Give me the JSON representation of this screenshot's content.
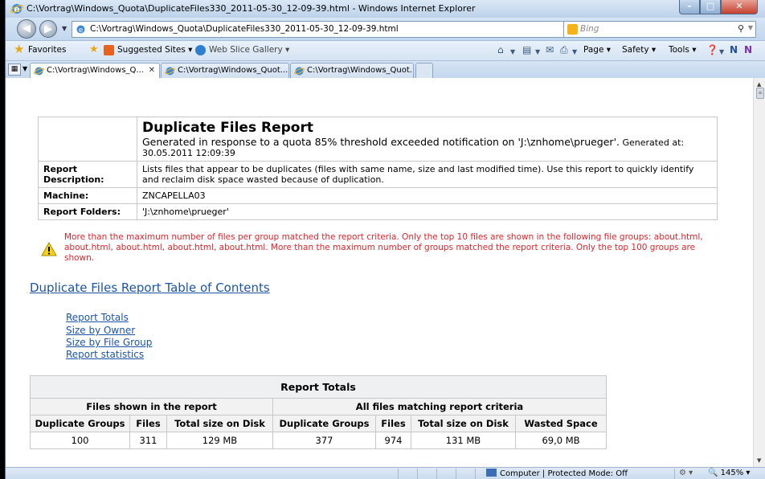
{
  "window": {
    "title": "C:\\Vortrag\\Windows_Quota\\DuplicateFiles330_2011-05-30_12-09-39.html - Windows Internet Explorer",
    "controls": {
      "minimize": "–",
      "maximize": "□",
      "close": "✕"
    }
  },
  "address": {
    "url": "C:\\Vortrag\\Windows_Quota\\DuplicateFiles330_2011-05-30_12-09-39.html",
    "search_placeholder": "Bing"
  },
  "favorites_bar": {
    "favorites": "Favorites",
    "suggested_sites": "Suggested Sites ▾",
    "web_slice_gallery": "Web Slice Gallery ▾"
  },
  "command_bar": {
    "page": "Page ▾",
    "safety": "Safety ▾",
    "tools": "Tools ▾"
  },
  "tabs": [
    {
      "label": "C:\\Vortrag\\Windows_Q...",
      "active": true
    },
    {
      "label": "C:\\Vortrag\\Windows_Quot...",
      "active": false
    },
    {
      "label": "C:\\Vortrag\\Windows_Quot...",
      "active": false
    }
  ],
  "report": {
    "title": "Duplicate Files Report",
    "subtitle": "Generated in response to a quota 85% threshold exceeded notification on 'J:\\znhome\\prueger'.",
    "generated": "Generated at: 30.05.2011 12:09:39",
    "rows": [
      {
        "label": "Report Description:",
        "value": "Lists files that appear to be duplicates (files with same name, size and last modified time). Use this report to quickly identify and reclaim disk space wasted because of duplication."
      },
      {
        "label": "Machine:",
        "value": "ZNCAPELLA03"
      },
      {
        "label": "Report Folders:",
        "value": "'J:\\znhome\\prueger'"
      }
    ]
  },
  "warning": {
    "text": "More than the maximum number of files per group matched the report criteria. Only the top 10 files are shown in the following file groups: about.html, about.html, about.html, about.html, about.html. More than the maximum number of groups matched the report criteria. Only the top 100 groups are shown."
  },
  "toc": {
    "heading": "Duplicate Files Report Table of Contents",
    "links": [
      "Report Totals",
      "Size by Owner",
      "Size by File Group",
      "Report statistics"
    ]
  },
  "totals": {
    "title": "Report Totals",
    "group_shown": "Files shown in the report",
    "group_all": "All files matching report criteria",
    "columns": [
      "Duplicate Groups",
      "Files",
      "Total size on Disk",
      "Duplicate Groups",
      "Files",
      "Total size on Disk",
      "Wasted Space"
    ],
    "values": [
      "100",
      "311",
      "129 MB",
      "377",
      "974",
      "131 MB",
      "69,0 MB"
    ]
  },
  "status": {
    "zone": "Computer | Protected Mode: Off",
    "zoom": "145%"
  }
}
